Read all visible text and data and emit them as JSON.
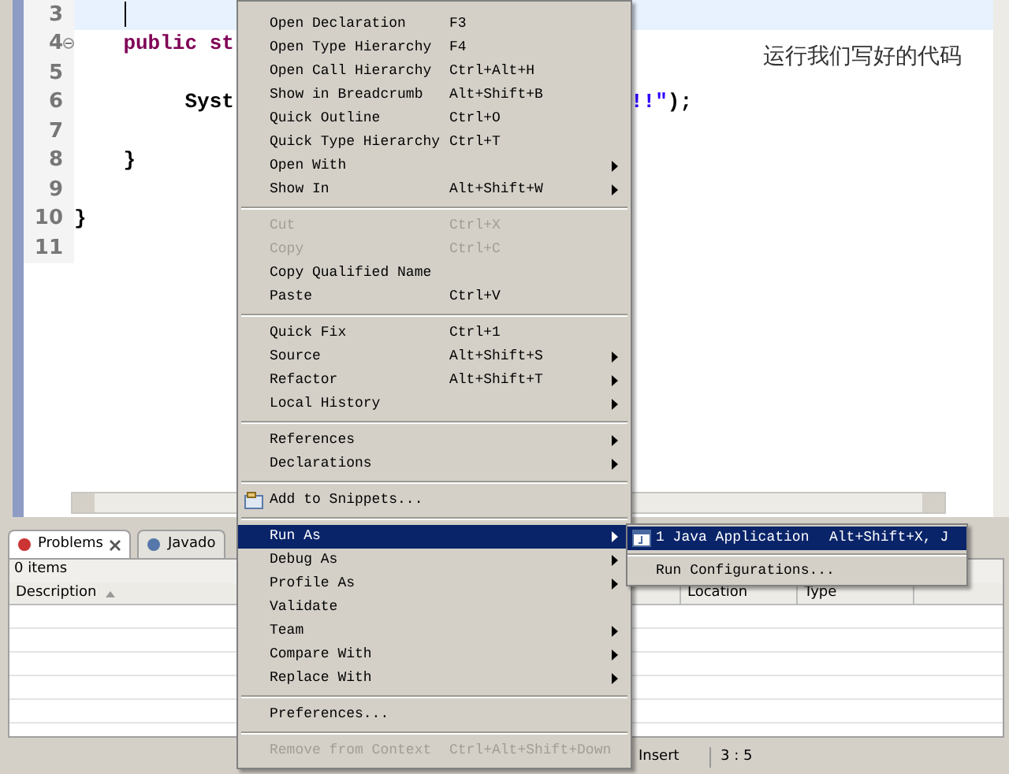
{
  "editor": {
    "lines": [
      {
        "number": "3",
        "current": true,
        "fold": false
      },
      {
        "number": "4",
        "current": false,
        "fold": true,
        "left": [
          {
            "text": "    public st",
            "kind": "keyword"
          }
        ]
      },
      {
        "number": "5",
        "current": false,
        "fold": false
      },
      {
        "number": "6",
        "current": false,
        "fold": false,
        "left": [
          {
            "text": "         Syst",
            "kind": "plain"
          }
        ],
        "right": [
          {
            "text": "!!\"",
            "kind": "string"
          },
          {
            "text": ");",
            "kind": "plain"
          }
        ]
      },
      {
        "number": "7",
        "current": false,
        "fold": false
      },
      {
        "number": "8",
        "current": false,
        "fold": false,
        "left": [
          {
            "text": "    }",
            "kind": "plain"
          }
        ]
      },
      {
        "number": "9",
        "current": false,
        "fold": false
      },
      {
        "number": "10",
        "current": false,
        "fold": false,
        "left": [
          {
            "text": "}",
            "kind": "plain"
          }
        ]
      },
      {
        "number": "11",
        "current": false,
        "fold": false
      }
    ]
  },
  "annotation": "运行我们写好的代码",
  "context_menu": [
    {
      "kind": "item",
      "label": "Open Declaration",
      "shortcut": "F3",
      "submenu": false,
      "disabled": false,
      "selected": false
    },
    {
      "kind": "item",
      "label": "Open Type Hierarchy",
      "shortcut": "F4",
      "submenu": false,
      "disabled": false,
      "selected": false
    },
    {
      "kind": "item",
      "label": "Open Call Hierarchy",
      "shortcut": "Ctrl+Alt+H",
      "submenu": false,
      "disabled": false,
      "selected": false
    },
    {
      "kind": "item",
      "label": "Show in Breadcrumb",
      "shortcut": "Alt+Shift+B",
      "submenu": false,
      "disabled": false,
      "selected": false
    },
    {
      "kind": "item",
      "label": "Quick Outline",
      "shortcut": "Ctrl+O",
      "submenu": false,
      "disabled": false,
      "selected": false
    },
    {
      "kind": "item",
      "label": "Quick Type Hierarchy",
      "shortcut": "Ctrl+T",
      "submenu": false,
      "disabled": false,
      "selected": false
    },
    {
      "kind": "item",
      "label": "Open With",
      "submenu": true,
      "disabled": false,
      "selected": false
    },
    {
      "kind": "item",
      "label": "Show In",
      "shortcut": "Alt+Shift+W",
      "submenu": true,
      "disabled": false,
      "selected": false
    },
    {
      "kind": "separator"
    },
    {
      "kind": "item",
      "label": "Cut",
      "shortcut": "Ctrl+X",
      "submenu": false,
      "disabled": true,
      "selected": false
    },
    {
      "kind": "item",
      "label": "Copy",
      "shortcut": "Ctrl+C",
      "submenu": false,
      "disabled": true,
      "selected": false
    },
    {
      "kind": "item",
      "label": "Copy Qualified Name",
      "submenu": false,
      "disabled": false,
      "selected": false
    },
    {
      "kind": "item",
      "label": "Paste",
      "shortcut": "Ctrl+V",
      "submenu": false,
      "disabled": false,
      "selected": false
    },
    {
      "kind": "separator"
    },
    {
      "kind": "item",
      "label": "Quick Fix",
      "shortcut": "Ctrl+1",
      "submenu": false,
      "disabled": false,
      "selected": false
    },
    {
      "kind": "item",
      "label": "Source",
      "shortcut": "Alt+Shift+S",
      "submenu": true,
      "disabled": false,
      "selected": false
    },
    {
      "kind": "item",
      "label": "Refactor",
      "shortcut": "Alt+Shift+T",
      "submenu": true,
      "disabled": false,
      "selected": false
    },
    {
      "kind": "item",
      "label": "Local History",
      "submenu": true,
      "disabled": false,
      "selected": false
    },
    {
      "kind": "separator"
    },
    {
      "kind": "item",
      "label": "References",
      "submenu": true,
      "disabled": false,
      "selected": false
    },
    {
      "kind": "item",
      "label": "Declarations",
      "submenu": true,
      "disabled": false,
      "selected": false
    },
    {
      "kind": "separator"
    },
    {
      "kind": "snippet",
      "label": "Add to Snippets...",
      "submenu": false,
      "disabled": false,
      "selected": false
    },
    {
      "kind": "separator"
    },
    {
      "kind": "item",
      "label": "Run As",
      "submenu": true,
      "disabled": false,
      "selected": true
    },
    {
      "kind": "item",
      "label": "Debug As",
      "submenu": true,
      "disabled": false,
      "selected": false
    },
    {
      "kind": "item",
      "label": "Profile As",
      "submenu": true,
      "disabled": false,
      "selected": false
    },
    {
      "kind": "item",
      "label": "Validate",
      "submenu": false,
      "disabled": false,
      "selected": false
    },
    {
      "kind": "item",
      "label": "Team",
      "submenu": true,
      "disabled": false,
      "selected": false
    },
    {
      "kind": "item",
      "label": "Compare With",
      "submenu": true,
      "disabled": false,
      "selected": false
    },
    {
      "kind": "item",
      "label": "Replace With",
      "submenu": true,
      "disabled": false,
      "selected": false
    },
    {
      "kind": "separator"
    },
    {
      "kind": "item",
      "label": "Preferences...",
      "submenu": false,
      "disabled": false,
      "selected": false
    },
    {
      "kind": "separator"
    },
    {
      "kind": "item",
      "label": "Remove from Context",
      "shortcut": "Ctrl+Alt+Shift+Down",
      "submenu": false,
      "disabled": true,
      "selected": false
    }
  ],
  "submenu": [
    {
      "kind": "app",
      "label": "1 Java Application",
      "shortcut": "Alt+Shift+X, J",
      "selected": true
    },
    {
      "kind": "separator"
    },
    {
      "kind": "item",
      "label": "Run Configurations...",
      "selected": false
    }
  ],
  "panel": {
    "tabs": [
      {
        "label": "Problems",
        "selected": true,
        "closable": true
      },
      {
        "label": "Javado",
        "selected": false,
        "closable": false
      }
    ],
    "summary": "0 items",
    "columns": [
      {
        "label": "Description",
        "sorted": true
      },
      {
        "label": "Location"
      },
      {
        "label": "Type"
      }
    ]
  },
  "status_bar": {
    "mode": "Insert",
    "position": "3 : 5"
  }
}
